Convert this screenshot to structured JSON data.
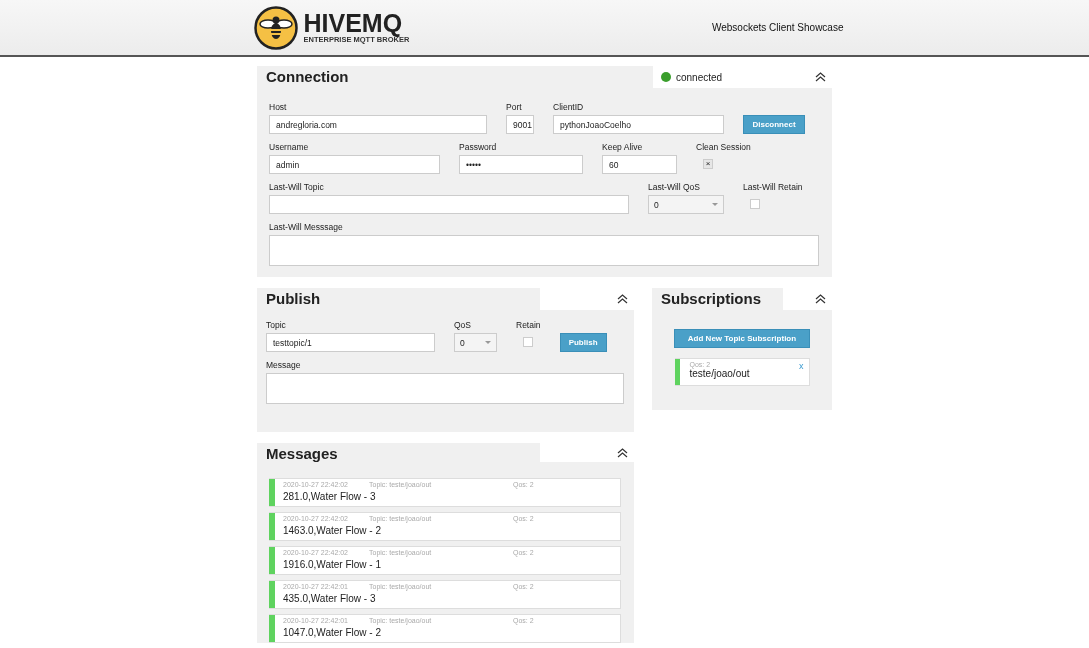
{
  "header": {
    "logo_title": "HIVEMQ",
    "logo_subtitle": "ENTERPRISE MQTT BROKER",
    "title": "Websockets Client Showcase"
  },
  "connection": {
    "title": "Connection",
    "status": {
      "label": "connected",
      "connected": true
    },
    "rows": [
      [
        {
          "kind": "text",
          "label": "Host",
          "value": "andregloria.com"
        },
        {
          "kind": "text",
          "label": "Port",
          "value": "9001"
        },
        {
          "kind": "text",
          "label": "ClientID",
          "value": "pythonJoaoCoelho"
        },
        {
          "kind": "button",
          "label": "Disconnect"
        }
      ],
      [
        {
          "kind": "text",
          "label": "Username",
          "value": "admin"
        },
        {
          "kind": "text",
          "label": "Password",
          "value": "•••••"
        },
        {
          "kind": "text",
          "label": "Keep Alive",
          "value": "60"
        },
        {
          "kind": "checkbox",
          "label": "Clean Session",
          "checked": true,
          "mark": "×"
        }
      ],
      [
        {
          "kind": "text",
          "label": "Last-Will Topic"
        },
        {
          "kind": "select",
          "label": "Last-Will QoS",
          "value": "0"
        },
        {
          "kind": "checkbox",
          "label": "Last-Will Retain",
          "checked": false
        }
      ],
      [
        {
          "kind": "textarea",
          "label": "Last-Will Messsage"
        }
      ]
    ]
  },
  "publish": {
    "title": "Publish",
    "rows": [
      [
        {
          "kind": "text",
          "label": "Topic",
          "value": "testtopic/1"
        },
        {
          "kind": "select",
          "label": "QoS",
          "value": "0"
        },
        {
          "kind": "checkbox",
          "label": "Retain",
          "checked": false
        },
        {
          "kind": "button",
          "label": "Publish"
        }
      ],
      [
        {
          "kind": "textarea",
          "label": "Message"
        }
      ]
    ]
  },
  "subscriptions": {
    "title": "Subscriptions",
    "button": "Add New Topic Subscription",
    "items": [
      {
        "qos": "Qos: 2",
        "topic": "teste/joao/out",
        "close": "x",
        "color": "#5fd35f"
      }
    ]
  },
  "messages": {
    "title": "Messages",
    "items": [
      {
        "time": "2020-10-27 22:42:02",
        "topic": "Topic: teste/joao/out",
        "qos": "Qos: 2",
        "text": "281.0,Water Flow - 3",
        "color": "#5fd35f"
      },
      {
        "time": "2020-10-27 22:42:02",
        "topic": "Topic: teste/joao/out",
        "qos": "Qos: 2",
        "text": "1463.0,Water Flow - 2",
        "color": "#5fd35f"
      },
      {
        "time": "2020-10-27 22:42:02",
        "topic": "Topic: teste/joao/out",
        "qos": "Qos: 2",
        "text": "1916.0,Water Flow - 1",
        "color": "#5fd35f"
      },
      {
        "time": "2020-10-27 22:42:01",
        "topic": "Topic: teste/joao/out",
        "qos": "Qos: 2",
        "text": "435.0,Water Flow - 3",
        "color": "#5fd35f"
      },
      {
        "time": "2020-10-27 22:42:01",
        "topic": "Topic: teste/joao/out",
        "qos": "Qos: 2",
        "text": "1047.0,Water Flow - 2",
        "color": "#5fd35f"
      }
    ]
  }
}
